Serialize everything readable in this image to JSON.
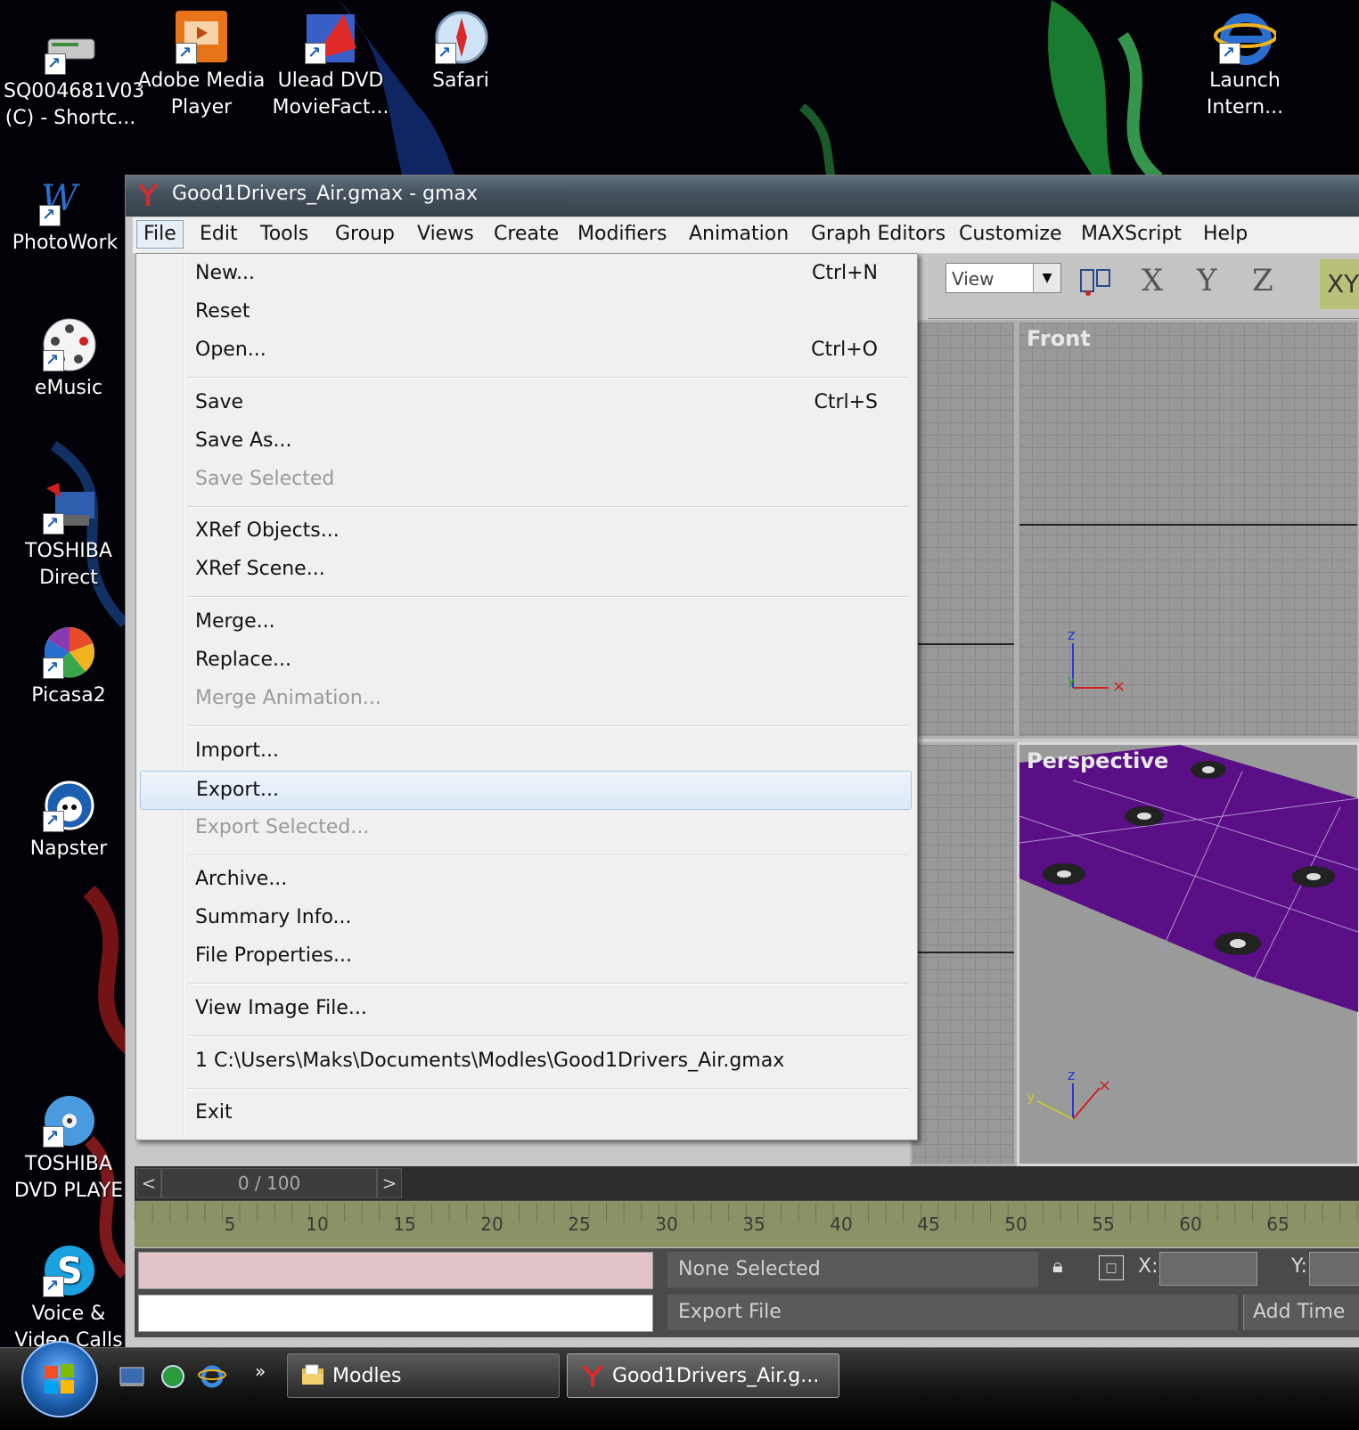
{
  "desktop": {
    "icons": [
      {
        "name": "SQ004681V03\n(C) - Shortc..."
      },
      {
        "name": "Adobe Media\nPlayer"
      },
      {
        "name": "Ulead DVD\nMovieFact..."
      },
      {
        "name": "Safari"
      },
      {
        "name": "Launch\nIntern..."
      },
      {
        "name": "PhotoWork"
      },
      {
        "name": "eMusic"
      },
      {
        "name": "TOSHIBA\nDirect"
      },
      {
        "name": "Picasa2"
      },
      {
        "name": "Napster"
      },
      {
        "name": "TOSHIBA\nDVD PLAYE"
      },
      {
        "name": "Voice &\nVideo Calls"
      }
    ]
  },
  "window": {
    "title": "Good1Drivers_Air.gmax - gmax"
  },
  "menubar": {
    "items": [
      "File",
      "Edit",
      "Tools",
      "Group",
      "Views",
      "Create",
      "Modifiers",
      "Animation",
      "Graph Editors",
      "Customize",
      "MAXScript",
      "Help"
    ]
  },
  "toolbar": {
    "view_dropdown": "View",
    "axis_x": "X",
    "axis_y": "Y",
    "axis_z": "Z",
    "axis_xy": "XY"
  },
  "viewports": {
    "front_label": "Front",
    "perspective_label": "Perspective"
  },
  "file_menu": {
    "items": [
      {
        "label": "New...",
        "shortcut": "Ctrl+N",
        "enabled": true
      },
      {
        "label": "Reset",
        "shortcut": "",
        "enabled": true
      },
      {
        "label": "Open...",
        "shortcut": "Ctrl+O",
        "enabled": true
      },
      {
        "label": "Save",
        "shortcut": "Ctrl+S",
        "enabled": true
      },
      {
        "label": "Save As...",
        "shortcut": "",
        "enabled": true
      },
      {
        "label": "Save Selected",
        "shortcut": "",
        "enabled": false
      },
      {
        "label": "XRef Objects...",
        "shortcut": "",
        "enabled": true
      },
      {
        "label": "XRef Scene...",
        "shortcut": "",
        "enabled": true
      },
      {
        "label": "Merge...",
        "shortcut": "",
        "enabled": true
      },
      {
        "label": "Replace...",
        "shortcut": "",
        "enabled": true
      },
      {
        "label": "Merge Animation...",
        "shortcut": "",
        "enabled": false
      },
      {
        "label": "Import...",
        "shortcut": "",
        "enabled": true
      },
      {
        "label": "Export...",
        "shortcut": "",
        "enabled": true,
        "highlighted": true
      },
      {
        "label": "Export Selected...",
        "shortcut": "",
        "enabled": false
      },
      {
        "label": "Archive...",
        "shortcut": "",
        "enabled": true
      },
      {
        "label": "Summary Info...",
        "shortcut": "",
        "enabled": true
      },
      {
        "label": "File Properties...",
        "shortcut": "",
        "enabled": true
      },
      {
        "label": "View Image File...",
        "shortcut": "",
        "enabled": true
      },
      {
        "label": "1 C:\\Users\\Maks\\Documents\\Modles\\Good1Drivers_Air.gmax",
        "shortcut": "",
        "enabled": true
      },
      {
        "label": "Exit",
        "shortcut": "",
        "enabled": true
      }
    ]
  },
  "timeline": {
    "slider_value": "0 / 100",
    "prev_arrow": "<",
    "next_arrow": ">",
    "ticks": [
      "5",
      "10",
      "15",
      "20",
      "25",
      "30",
      "35",
      "40",
      "45",
      "50",
      "55",
      "60",
      "65"
    ]
  },
  "status": {
    "selection": "None Selected",
    "prompt": "Export File",
    "add_time": "Add Time",
    "x_label": "X:",
    "y_label": "Y:"
  },
  "taskbar": {
    "chevron": "»",
    "buttons": [
      {
        "label": "Modles"
      },
      {
        "label": "Good1Drivers_Air.g..."
      }
    ]
  },
  "colors": {
    "menu_bg": "#f0f0f0",
    "highlight": "#dde9f7",
    "perspective_plane": "#5b0f87",
    "ruler": "#8c9166"
  }
}
